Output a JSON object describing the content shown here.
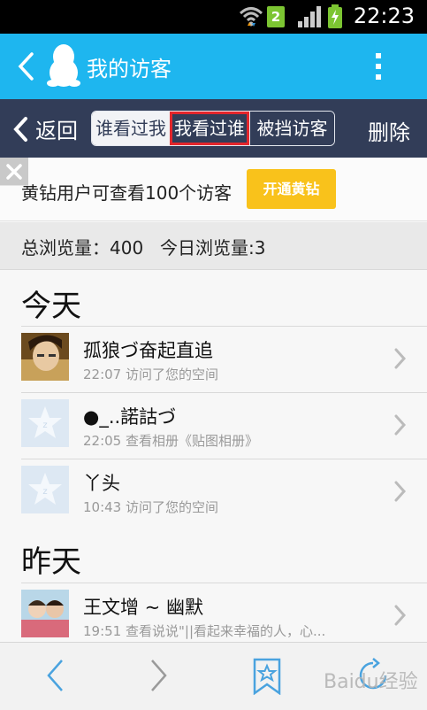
{
  "status_bar": {
    "time": "22:23",
    "sim_badge": "2",
    "icons": [
      "wifi-icon",
      "sim-badge-icon",
      "signal-icon",
      "battery-charging-icon"
    ]
  },
  "app_bar": {
    "title": "我的访客",
    "icons": [
      "back-arrow-icon",
      "qq-penguin-icon",
      "more-vertical-icon"
    ]
  },
  "nav_bar": {
    "back_label": "返回",
    "tabs": [
      {
        "label": "谁看过我"
      },
      {
        "label": "我看过谁"
      },
      {
        "label": "被挡访客"
      }
    ],
    "delete_label": "删除"
  },
  "promo": {
    "text": "黄钻用户可查看100个访客",
    "button_label": "开通黄钻"
  },
  "stats": {
    "total": "总浏览量：400",
    "today": "今日浏览量:3"
  },
  "sections": [
    {
      "header": "今天",
      "items": [
        {
          "name": "孤狼づ奋起直追",
          "meta": "22:07 访问了您的空间",
          "avatar": "photo-avatar"
        },
        {
          "name": "●_..諾詁づ",
          "meta": "22:05 查看相册《贴图相册》",
          "avatar": "default-avatar"
        },
        {
          "name": "丫头",
          "meta": "10:43 访问了您的空间",
          "avatar": "default-avatar"
        }
      ]
    },
    {
      "header": "昨天",
      "items": [
        {
          "name": "王文增 ~ 幽默",
          "meta": "19:51 查看说说\"||看起来幸福的人，心...",
          "avatar": "photo-avatar"
        }
      ]
    }
  ],
  "bottom_bar": {
    "icons": [
      "prev-arrow-icon",
      "next-arrow-icon",
      "bookmark-star-icon",
      "refresh-icon"
    ]
  },
  "watermark": "Baidu经验",
  "colors": {
    "app_bar": "#1eb6ef",
    "nav_bar": "#323d58",
    "highlight_box": "#e3262c",
    "promo_button": "#f9c21b"
  }
}
